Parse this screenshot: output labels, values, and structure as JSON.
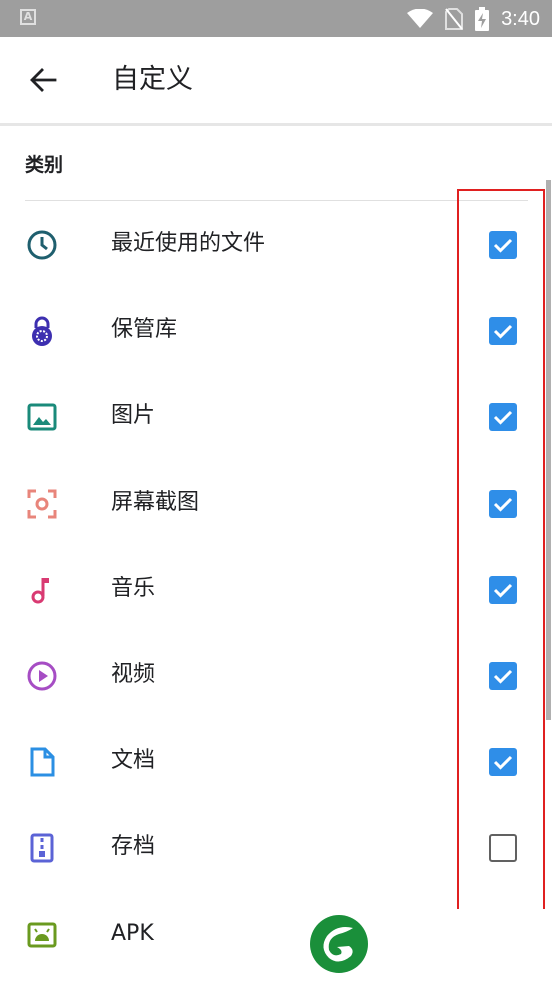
{
  "status_bar": {
    "left_icon": "A",
    "time": "3:40",
    "icons": [
      "wifi-icon",
      "no-sim-icon",
      "battery-charging-icon"
    ]
  },
  "app_bar": {
    "back_icon": "arrow-back-icon",
    "title": "自定义"
  },
  "section": {
    "title": "类别"
  },
  "items": [
    {
      "label": "最近使用的文件",
      "icon": "clock-icon",
      "checked": true
    },
    {
      "label": "保管库",
      "icon": "lock-icon",
      "checked": true
    },
    {
      "label": "图片",
      "icon": "image-icon",
      "checked": true
    },
    {
      "label": "屏幕截图",
      "icon": "screenshot-icon",
      "checked": true
    },
    {
      "label": "音乐",
      "icon": "music-note-icon",
      "checked": true
    },
    {
      "label": "视频",
      "icon": "play-icon",
      "checked": true
    },
    {
      "label": "文档",
      "icon": "document-icon",
      "checked": true
    },
    {
      "label": "存档",
      "icon": "archive-icon",
      "checked": false
    },
    {
      "label": "APK",
      "icon": "android-icon",
      "checked": null
    }
  ],
  "colors": {
    "checkbox_on": "#2f8ee8",
    "highlight": "#e02020",
    "status_bar": "#9e9e9e"
  }
}
